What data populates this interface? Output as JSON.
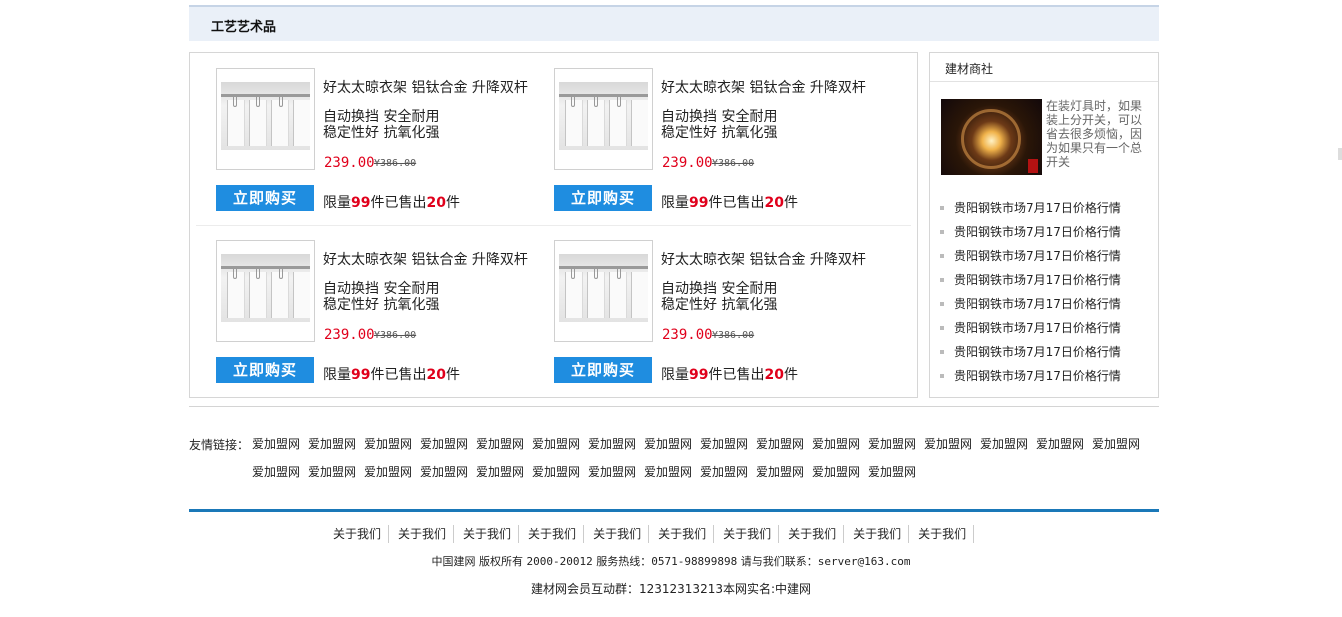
{
  "section": {
    "title": "工艺艺术品"
  },
  "products": [
    {
      "title": "好太太晾衣架 铝钛合金 升降双杆",
      "desc1": "自动换挡 安全耐用",
      "desc2": "稳定性好 抗氧化强",
      "price": "239.00",
      "old_price": "¥386.00",
      "buy_label": "立即购买",
      "sold_prefix": "限量",
      "limit": "99",
      "sold_middle": "件已售出",
      "sold": "20",
      "sold_suffix": "件"
    },
    {
      "title": "好太太晾衣架 铝钛合金 升降双杆",
      "desc1": "自动换挡 安全耐用",
      "desc2": "稳定性好 抗氧化强",
      "price": "239.00",
      "old_price": "¥386.00",
      "buy_label": "立即购买",
      "sold_prefix": "限量",
      "limit": "99",
      "sold_middle": "件已售出",
      "sold": "20",
      "sold_suffix": "件"
    },
    {
      "title": "好太太晾衣架 铝钛合金 升降双杆",
      "desc1": "自动换挡 安全耐用",
      "desc2": "稳定性好 抗氧化强",
      "price": "239.00",
      "old_price": "¥386.00",
      "buy_label": "立即购买",
      "sold_prefix": "限量",
      "limit": "99",
      "sold_middle": "件已售出",
      "sold": "20",
      "sold_suffix": "件"
    },
    {
      "title": "好太太晾衣架 铝钛合金 升降双杆",
      "desc1": "自动换挡 安全耐用",
      "desc2": "稳定性好 抗氧化强",
      "price": "239.00",
      "old_price": "¥386.00",
      "buy_label": "立即购买",
      "sold_prefix": "限量",
      "limit": "99",
      "sold_middle": "件已售出",
      "sold": "20",
      "sold_suffix": "件"
    }
  ],
  "side": {
    "title": "建材商社",
    "feature_text": "在装灯具时，如果装上分开关，可以省去很多烦恼，因为如果只有一个总开关",
    "news": [
      "贵阳钢铁市场7月17日价格行情",
      "贵阳钢铁市场7月17日价格行情",
      "贵阳钢铁市场7月17日价格行情",
      "贵阳钢铁市场7月17日价格行情",
      "贵阳钢铁市场7月17日价格行情",
      "贵阳钢铁市场7月17日价格行情",
      "贵阳钢铁市场7月17日价格行情",
      "贵阳钢铁市场7月17日价格行情"
    ]
  },
  "friend_links": {
    "label": "友情链接：",
    "items": [
      "爱加盟网",
      "爱加盟网",
      "爱加盟网",
      "爱加盟网",
      "爱加盟网",
      "爱加盟网",
      "爱加盟网",
      "爱加盟网",
      "爱加盟网",
      "爱加盟网",
      "爱加盟网",
      "爱加盟网",
      "爱加盟网",
      "爱加盟网",
      "爱加盟网",
      "爱加盟网",
      "爱加盟网",
      "爱加盟网",
      "爱加盟网",
      "爱加盟网",
      "爱加盟网",
      "爱加盟网",
      "爱加盟网",
      "爱加盟网",
      "爱加盟网",
      "爱加盟网",
      "爱加盟网",
      "爱加盟网"
    ]
  },
  "footer": {
    "nav": [
      "关于我们",
      "关于我们",
      "关于我们",
      "关于我们",
      "关于我们",
      "关于我们",
      "关于我们",
      "关于我们",
      "关于我们",
      "关于我们"
    ],
    "copyright_1": "中国建网 版权所有 ",
    "copyright_years": "2000-20012",
    "copyright_2": " 服务热线：",
    "hotline": "0571-98899898",
    "copyright_3": " 请与我们联系：",
    "email": "server@163.com",
    "group_line": "建材网会员互动群：12312313213本网实名:中建网"
  }
}
